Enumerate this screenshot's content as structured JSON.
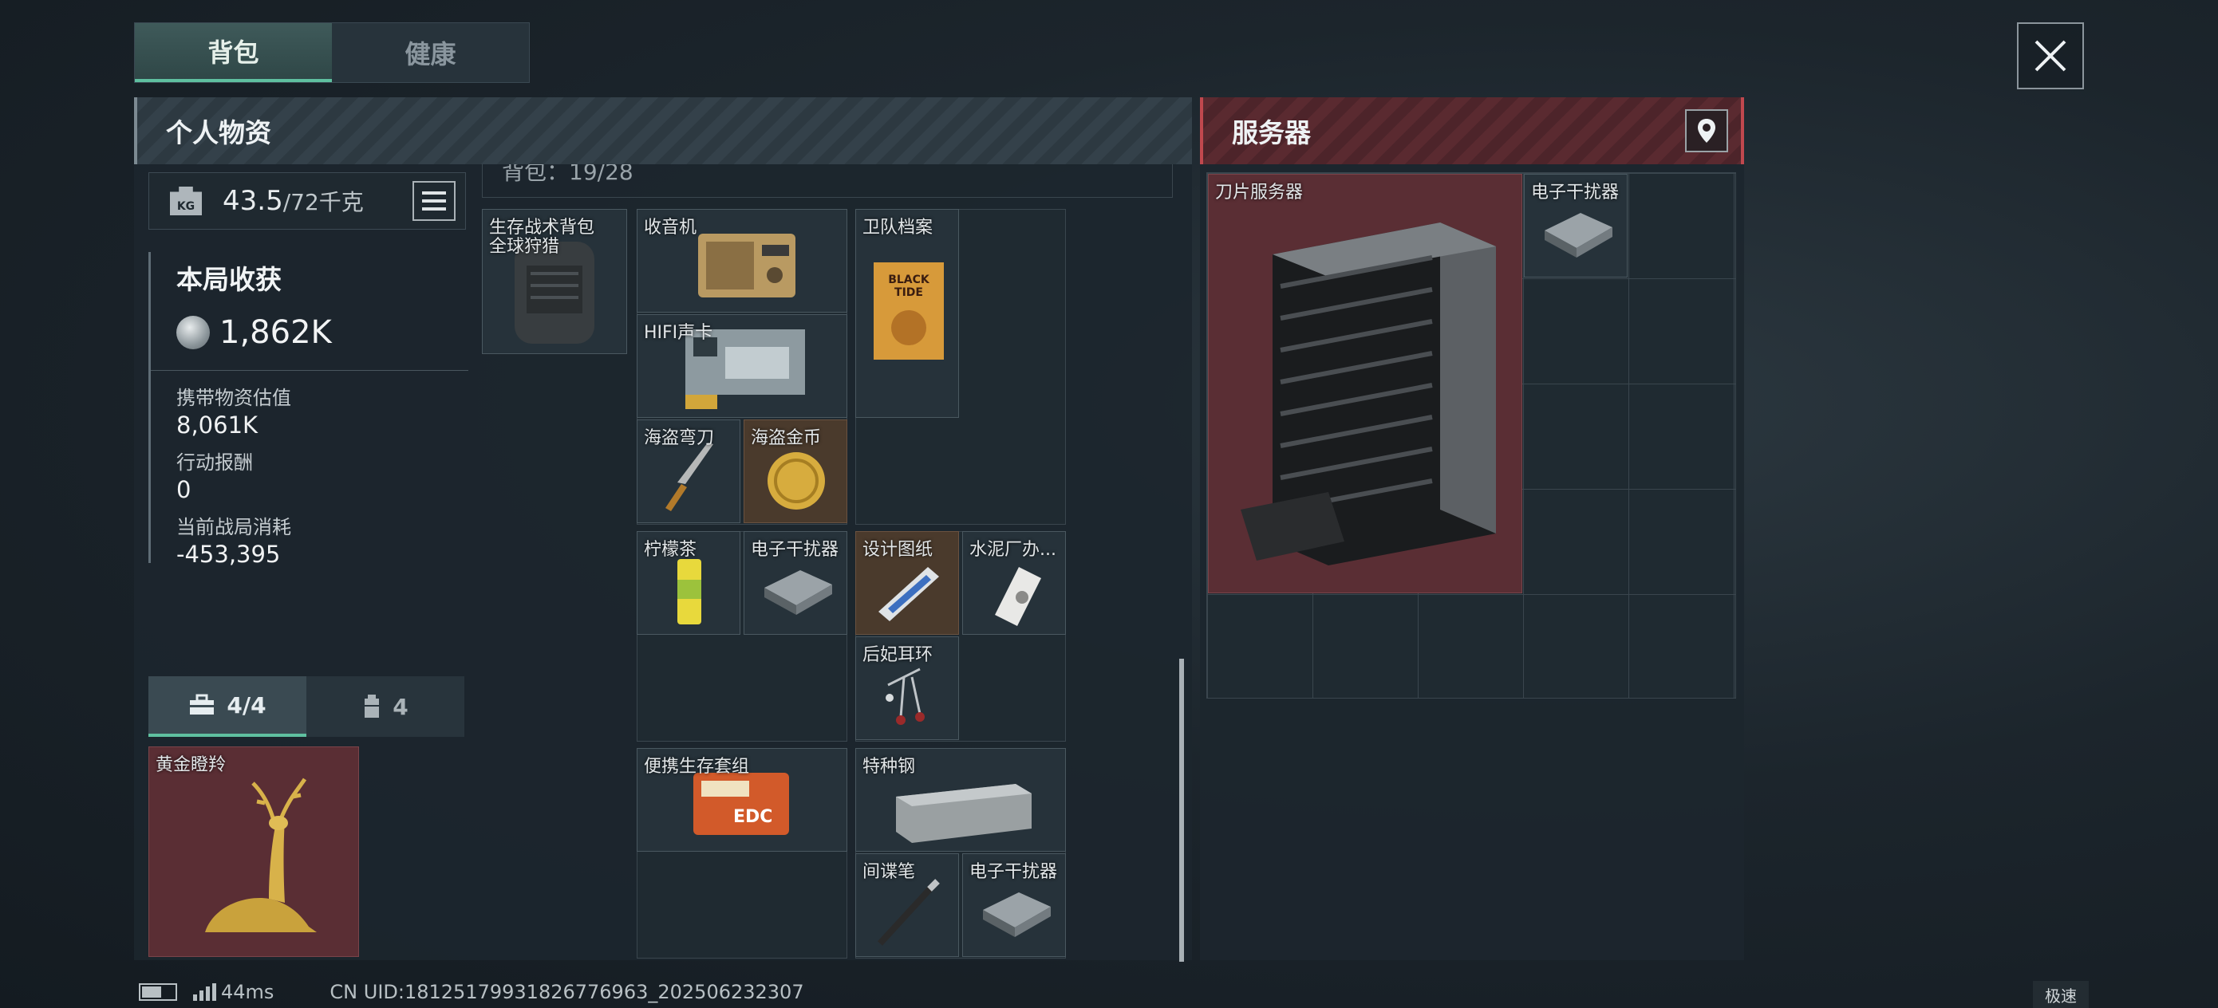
{
  "tabs": [
    {
      "label": "背包"
    },
    {
      "label": "健康"
    }
  ],
  "personal_header": "个人物资",
  "server_header": "服务器",
  "weight": {
    "icon_label": "KG",
    "current": "43.5",
    "max": "/72千克"
  },
  "stats": {
    "title": "本局收获",
    "harvest": "1,862K",
    "carried_label": "携带物资估值",
    "carried_value": "8,061K",
    "reward_label": "行动报酬",
    "reward_value": "0",
    "cost_label": "当前战局消耗",
    "cost_value": "-453,395"
  },
  "slot_tabs": [
    {
      "label": "4/4"
    },
    {
      "label": "4"
    }
  ],
  "bag_hint": "背包：19/28",
  "items": {
    "backpack": "生存战术背包",
    "backpack_sub": "全球狩猎",
    "radio": "收音机",
    "hifi": "HIFI声卡",
    "pirate_knife": "海盗弯刀",
    "pirate_coin": "海盗金币",
    "guard_file": "卫队档案",
    "guard_file_cover": "BLACK TIDE",
    "lemon_tea": "柠檬茶",
    "jammer1": "电子干扰器",
    "blueprint": "设计图纸",
    "cement": "水泥厂办...",
    "earring": "后妃耳环",
    "survival_kit": "便携生存套组",
    "survival_kit_brand": "EDC",
    "special_steel": "特种钢",
    "spy_pen": "间谍笔",
    "jammer2": "电子干扰器",
    "golden_deer": "黄金瞪羚",
    "blade_server": "刀片服务器",
    "jammer3": "电子干扰器"
  },
  "status": {
    "ping": "44ms",
    "uid": "CN UID:18125179931826776963_202506232307",
    "battery_level": 0.6
  },
  "speed_label": "极速"
}
